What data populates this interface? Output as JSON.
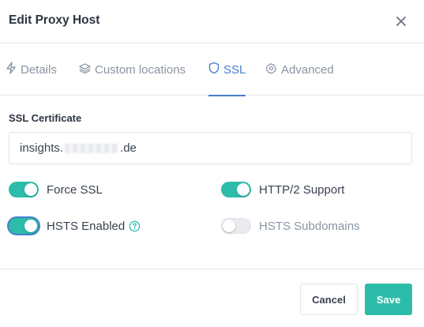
{
  "header": {
    "title": "Edit Proxy Host",
    "close_icon": "close-icon"
  },
  "tabs": [
    {
      "label": "Details",
      "icon": "bolt-icon"
    },
    {
      "label": "Custom locations",
      "icon": "layers-icon"
    },
    {
      "label": "SSL",
      "icon": "shield-icon",
      "active": true
    },
    {
      "label": "Advanced",
      "icon": "gear-icon"
    }
  ],
  "ssl": {
    "section_label": "SSL Certificate",
    "certificate_prefix": "insights.",
    "certificate_suffix": ".de",
    "toggles": {
      "force_ssl": {
        "label": "Force SSL",
        "on": true
      },
      "http2": {
        "label": "HTTP/2 Support",
        "on": true
      },
      "hsts_enabled": {
        "label": "HSTS Enabled",
        "on": true
      },
      "hsts_subdomains": {
        "label": "HSTS Subdomains",
        "on": false
      }
    }
  },
  "footer": {
    "cancel_label": "Cancel",
    "save_label": "Save"
  },
  "colors": {
    "accent": "#467fcf",
    "toggle_on": "#2dbca9",
    "save": "#2dbca9"
  }
}
